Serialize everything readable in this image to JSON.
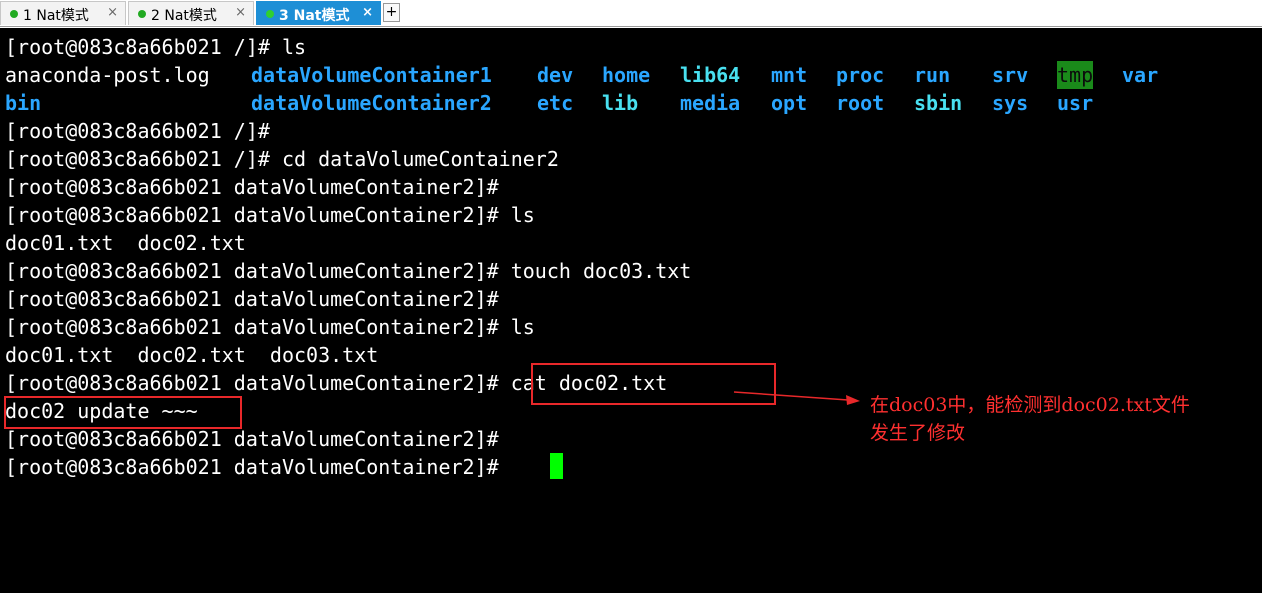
{
  "tabs": [
    {
      "label": "1 Nat模式",
      "close": "×"
    },
    {
      "label": "2 Nat模式",
      "close": "×"
    },
    {
      "label": "3 Nat模式",
      "close": "×"
    }
  ],
  "new_tab": "+",
  "terminal": {
    "lines": [
      "[root@083c8a66b021 /]# ls",
      "",
      "",
      "[root@083c8a66b021 /]#",
      "[root@083c8a66b021 /]# cd dataVolumeContainer2",
      "[root@083c8a66b021 dataVolumeContainer2]#",
      "[root@083c8a66b021 dataVolumeContainer2]# ls",
      "doc01.txt  doc02.txt",
      "[root@083c8a66b021 dataVolumeContainer2]# touch doc03.txt",
      "[root@083c8a66b021 dataVolumeContainer2]#",
      "[root@083c8a66b021 dataVolumeContainer2]# ls",
      "doc01.txt  doc02.txt  doc03.txt",
      "[root@083c8a66b021 dataVolumeContainer2]# cat doc02.txt",
      "doc02 update ~~~",
      "[root@083c8a66b021 dataVolumeContainer2]#",
      "[root@083c8a66b021 dataVolumeContainer2]# "
    ],
    "ls_row1": [
      {
        "text": "anaconda-post.log",
        "type": "file"
      },
      {
        "text": "dataVolumeContainer1",
        "type": "dir"
      },
      {
        "text": "dev",
        "type": "dir"
      },
      {
        "text": "home",
        "type": "dir"
      },
      {
        "text": "lib64",
        "type": "link"
      },
      {
        "text": "mnt",
        "type": "dir"
      },
      {
        "text": "proc",
        "type": "dir"
      },
      {
        "text": "run",
        "type": "dir"
      },
      {
        "text": "srv",
        "type": "dir"
      },
      {
        "text": "tmp",
        "type": "sticky"
      },
      {
        "text": "var",
        "type": "dir"
      }
    ],
    "ls_row2": [
      {
        "text": "bin",
        "type": "dir"
      },
      {
        "text": "dataVolumeContainer2",
        "type": "dir"
      },
      {
        "text": "etc",
        "type": "dir"
      },
      {
        "text": "lib",
        "type": "link"
      },
      {
        "text": "media",
        "type": "dir"
      },
      {
        "text": "opt",
        "type": "dir"
      },
      {
        "text": "root",
        "type": "dir"
      },
      {
        "text": "sbin",
        "type": "link"
      },
      {
        "text": "sys",
        "type": "dir"
      },
      {
        "text": "usr",
        "type": "dir"
      }
    ],
    "colors": {
      "dir": "#2aa6ff",
      "link": "#49e0f0",
      "sticky_bg": "#1a8a1a",
      "cursor": "#00ff00"
    }
  },
  "annotation": {
    "line1": "在doc03中，能检测到doc02.txt文件",
    "line2": "发生了修改",
    "color": "#e8282a"
  }
}
